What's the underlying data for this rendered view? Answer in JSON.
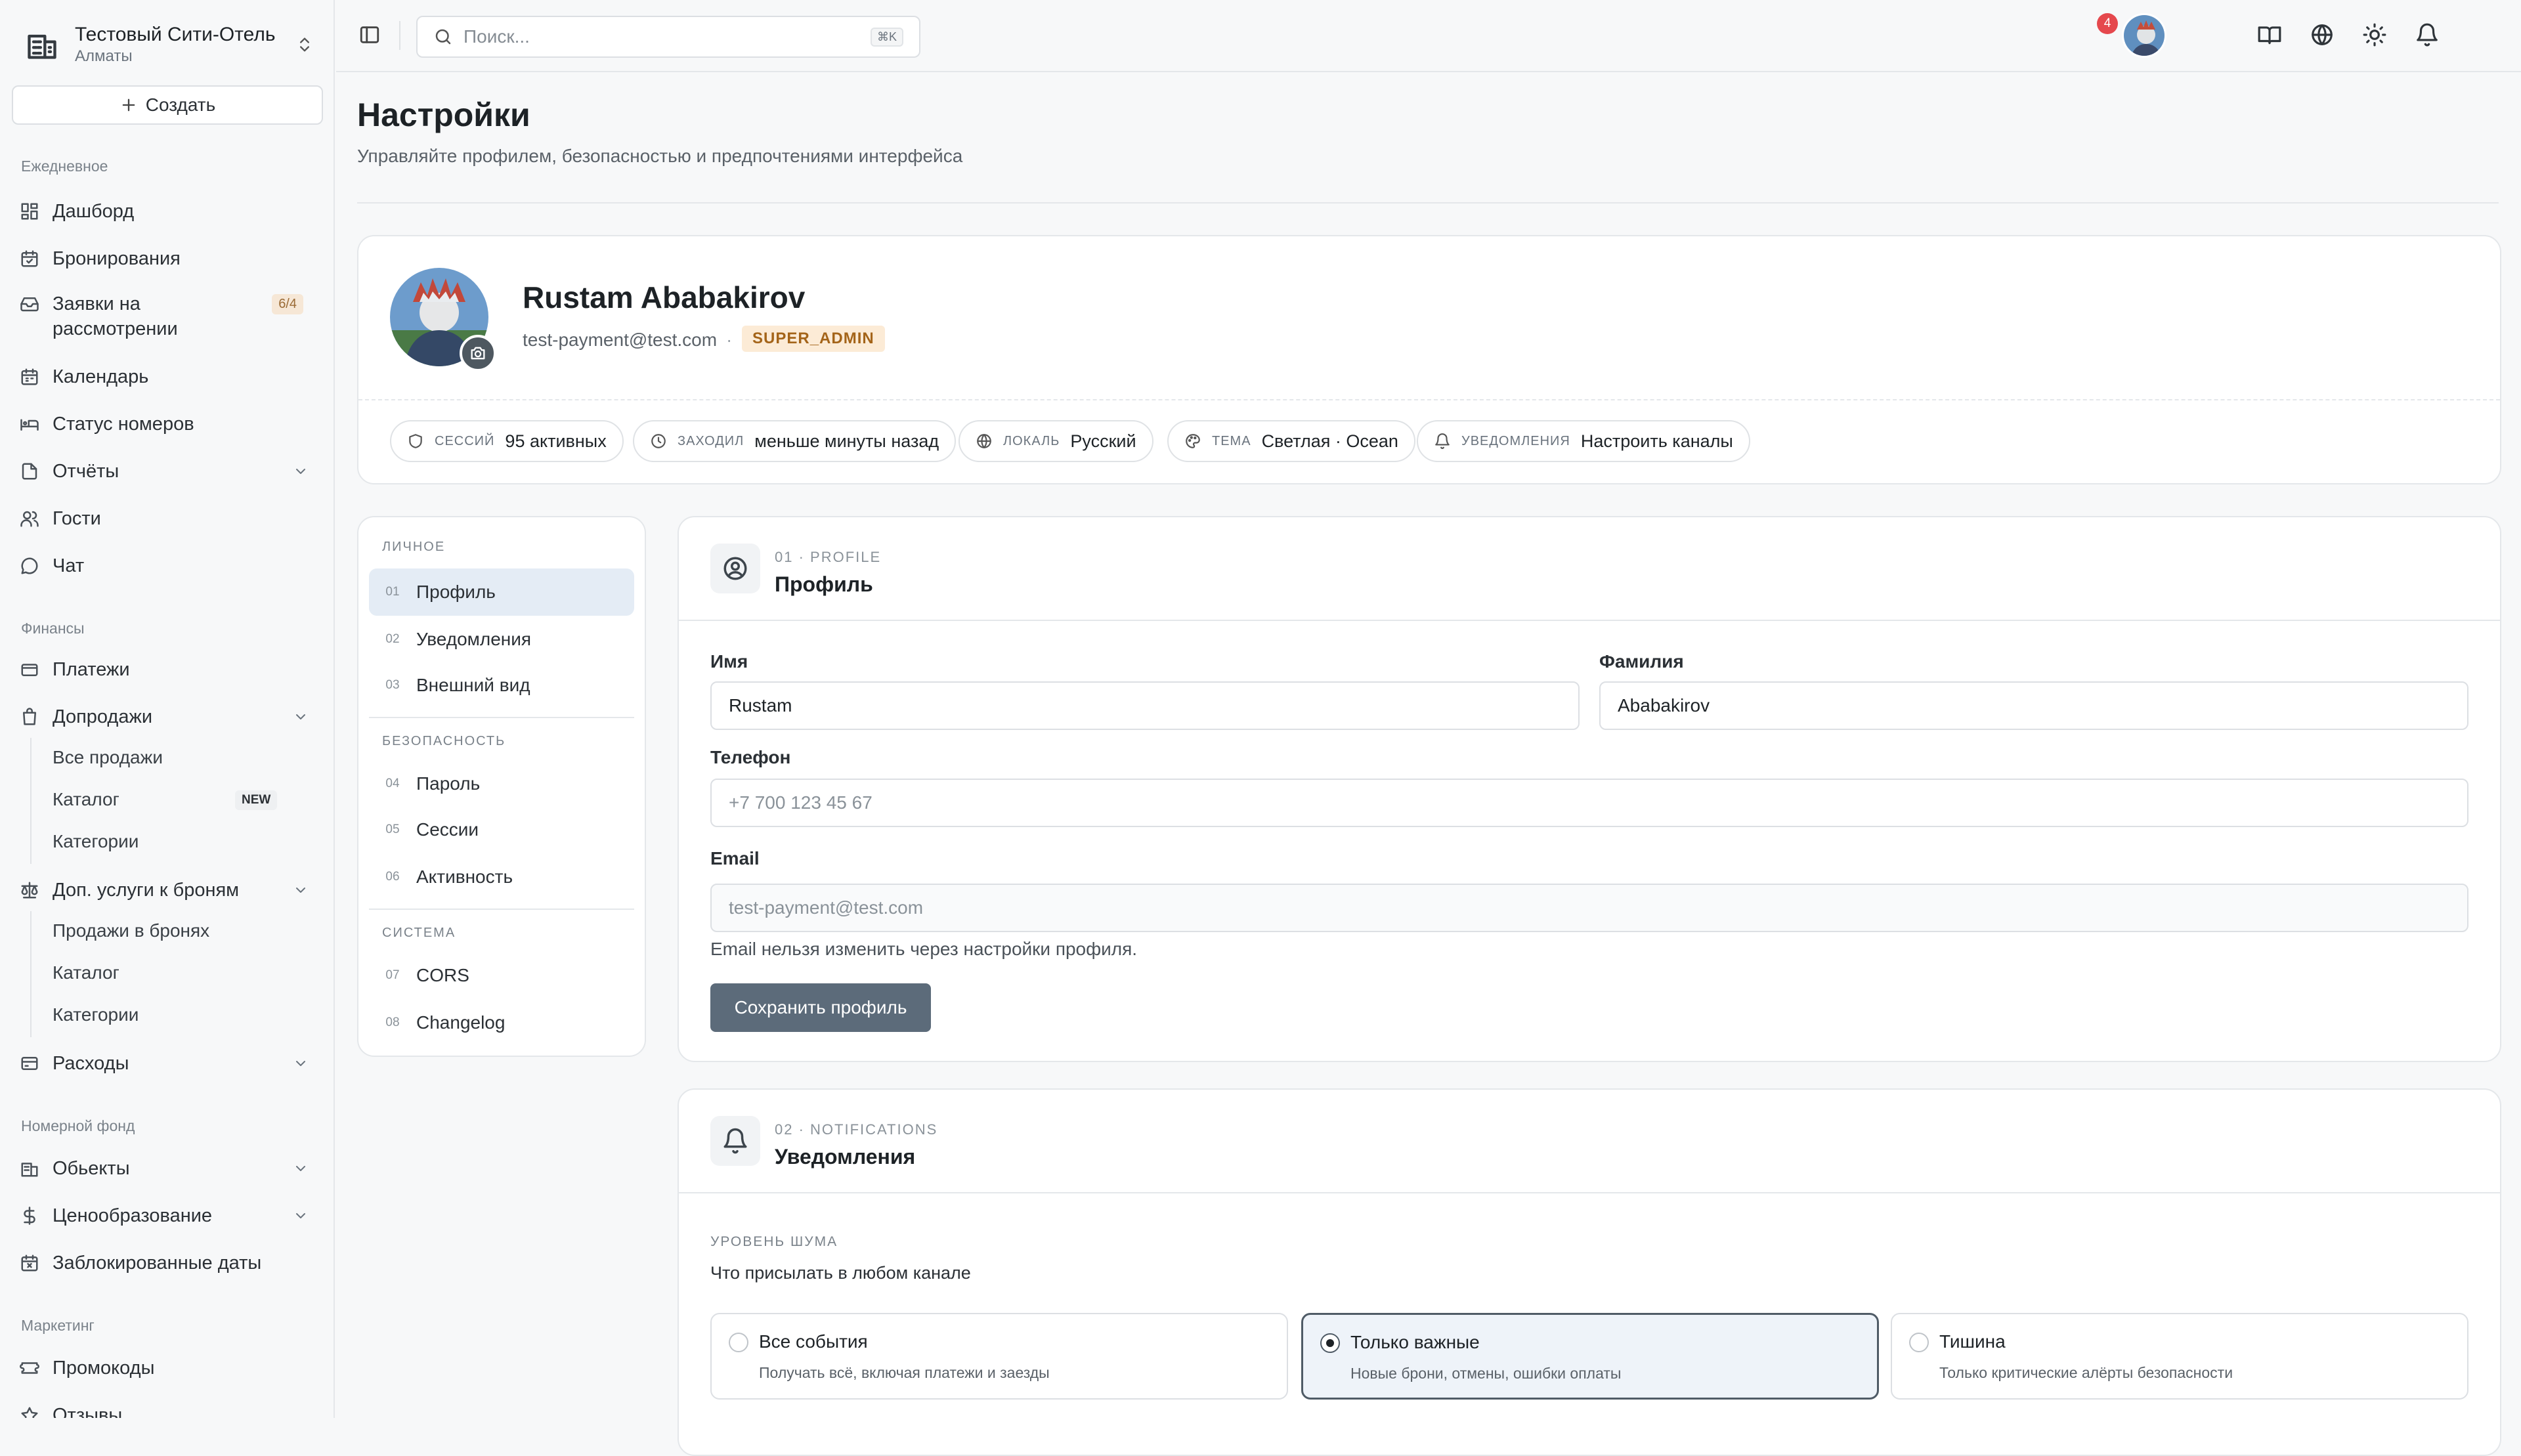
{
  "hotel": {
    "name": "Тестовый Сити-Отель",
    "city": "Алматы"
  },
  "create_label": "Создать",
  "sidebar": {
    "daily_title": "Ежедневное",
    "daily": [
      {
        "label": "Дашборд",
        "icon": "dashboard-icon"
      },
      {
        "label": "Бронирования",
        "icon": "calendar-check-icon"
      },
      {
        "label": "Заявки на\nрассмотрении",
        "icon": "inbox-icon",
        "badge": "6/4"
      },
      {
        "label": "Календарь",
        "icon": "calendar-icon"
      },
      {
        "label": "Статус номеров",
        "icon": "bed-icon"
      },
      {
        "label": "Отчёты",
        "icon": "file-icon"
      },
      {
        "label": "Гости",
        "icon": "users-icon"
      },
      {
        "label": "Чат",
        "icon": "chat-icon"
      }
    ],
    "finance_title": "Финансы",
    "finance": [
      {
        "label": "Платежи",
        "icon": "wallet-icon"
      },
      {
        "label": "Допродажи",
        "icon": "bag-icon"
      }
    ],
    "upsell_sub": [
      {
        "label": "Все продажи"
      },
      {
        "label": "Каталог",
        "badge": "NEW"
      },
      {
        "label": "Категории"
      }
    ],
    "addons": {
      "label": "Доп. услуги к броням",
      "icon": "scale-icon"
    },
    "addons_sub": [
      {
        "label": "Продажи в бронях"
      },
      {
        "label": "Каталог"
      },
      {
        "label": "Категории"
      }
    ],
    "expenses": {
      "label": "Расходы",
      "icon": "receipt-icon"
    },
    "rooms_title": "Номерной фонд",
    "rooms": [
      {
        "label": "Обьекты",
        "icon": "building-icon"
      },
      {
        "label": "Ценообразование",
        "icon": "dollar-icon"
      },
      {
        "label": "Заблокированные даты",
        "icon": "calendar-x-icon"
      }
    ],
    "marketing_title": "Маркетинг",
    "marketing": [
      {
        "label": "Промокоды",
        "icon": "ticket-icon"
      },
      {
        "label": "Отзывы",
        "icon": "star-icon"
      }
    ]
  },
  "topbar": {
    "search_placeholder": "Поиск...",
    "search_shortcut": "⌘K",
    "notification_count": "4"
  },
  "page": {
    "title": "Настройки",
    "subtitle": "Управляйте профилем, безопасностью и предпочтениями интерфейса"
  },
  "profile": {
    "name": "Rustam Ababakirov",
    "email": "test-payment@test.com",
    "separator": "·",
    "role": "SUPER_ADMIN",
    "stats": [
      {
        "key": "сессий",
        "value": "95 активных",
        "icon": "shield-icon"
      },
      {
        "key": "заходил",
        "value": "меньше минуты назад",
        "icon": "clock-icon"
      },
      {
        "key": "локаль",
        "value": "Русский",
        "icon": "globe-icon"
      },
      {
        "key": "тема",
        "value": "Светлая · Ocean",
        "icon": "palette-icon"
      },
      {
        "key": "уведомления",
        "value": "Настроить каналы",
        "icon": "bell-icon"
      }
    ]
  },
  "settings_nav": {
    "personal_title": "ЛИЧНОЕ",
    "personal": [
      {
        "num": "01",
        "label": "Профиль"
      },
      {
        "num": "02",
        "label": "Уведомления"
      },
      {
        "num": "03",
        "label": "Внешний вид"
      }
    ],
    "security_title": "БЕЗОПАСНОСТЬ",
    "security": [
      {
        "num": "04",
        "label": "Пароль"
      },
      {
        "num": "05",
        "label": "Сессии"
      },
      {
        "num": "06",
        "label": "Активность"
      }
    ],
    "system_title": "СИСТЕМА",
    "system": [
      {
        "num": "07",
        "label": "CORS"
      },
      {
        "num": "08",
        "label": "Changelog"
      }
    ]
  },
  "profile_form": {
    "kicker": "01 · PROFILE",
    "title": "Профиль",
    "first_name_label": "Имя",
    "first_name": "Rustam",
    "last_name_label": "Фамилия",
    "last_name": "Ababakirov",
    "phone_label": "Телефон",
    "phone_placeholder": "+7 700 123 45 67",
    "email_label": "Email",
    "email_value": "test-payment@test.com",
    "email_hint": "Email нельзя изменить через настройки профиля.",
    "save_label": "Сохранить профиль"
  },
  "notifications": {
    "kicker": "02 · NOTIFICATIONS",
    "title": "Уведомления",
    "noise_label": "УРОВЕНЬ ШУМА",
    "noise_question": "Что присылать в любом канале",
    "options": [
      {
        "title": "Все события",
        "desc": "Получать всё, включая платежи и заезды",
        "selected": false
      },
      {
        "title": "Только важные",
        "desc": "Новые брони, отмены, ошибки оплаты",
        "selected": true
      },
      {
        "title": "Тишина",
        "desc": "Только критические алёрты безопасности",
        "selected": false
      }
    ]
  }
}
